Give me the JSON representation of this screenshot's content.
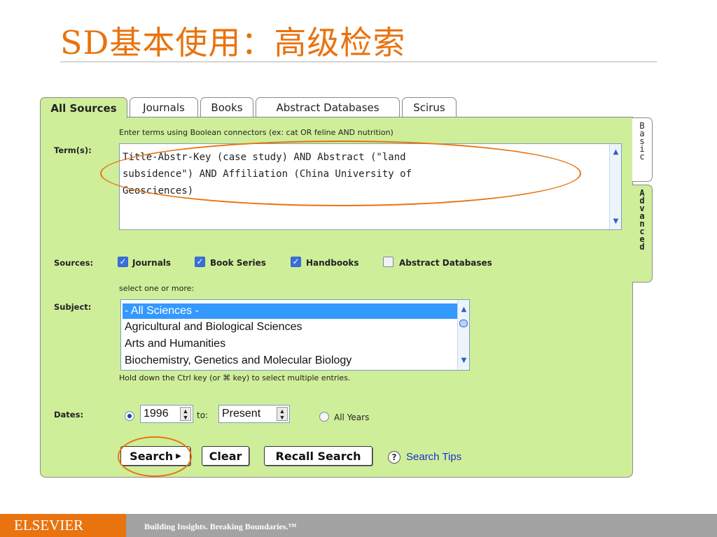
{
  "slide": {
    "title": "SD基本使用：高级检索"
  },
  "tabs": [
    {
      "label": "All Sources",
      "active": true
    },
    {
      "label": "Journals"
    },
    {
      "label": "Books"
    },
    {
      "label": "Abstract Databases"
    },
    {
      "label": "Scirus"
    }
  ],
  "side_tabs": {
    "basic": [
      "B",
      "a",
      "s",
      "i",
      "c"
    ],
    "advanced": [
      "A",
      "d",
      "v",
      "a",
      "n",
      "c",
      "e",
      "d"
    ]
  },
  "terms": {
    "label": "Term(s):",
    "hint": "Enter terms using Boolean connectors (ex: cat OR feline AND nutrition)",
    "lines": [
      "Title-Abstr-Key (case study) AND Abstract (\"land",
      "subsidence\") AND Affiliation (China University of",
      "Geosciences)"
    ]
  },
  "sources": {
    "label": "Sources:",
    "options": [
      {
        "label": "Journals",
        "checked": true
      },
      {
        "label": "Book Series",
        "checked": true
      },
      {
        "label": "Handbooks",
        "checked": true
      },
      {
        "label": "Abstract Databases",
        "checked": false
      }
    ]
  },
  "subject": {
    "label": "Subject:",
    "hint_top": "select one or more:",
    "hint_bottom": "Hold down the Ctrl key (or ⌘ key) to select multiple entries.",
    "items": [
      {
        "label": "- All Sciences -",
        "selected": true
      },
      {
        "label": "Agricultural and Biological Sciences"
      },
      {
        "label": "Arts and Humanities"
      },
      {
        "label": "Biochemistry, Genetics and Molecular Biology"
      }
    ]
  },
  "dates": {
    "label": "Dates:",
    "from_value": "1996",
    "to_label": "to:",
    "to_value": "Present",
    "all_years_label": "All Years",
    "range_selected": true
  },
  "actions": {
    "search": "Search",
    "clear": "Clear",
    "recall": "Recall Search",
    "tips": "Search Tips"
  },
  "footer": {
    "brand": "ELSEVIER",
    "tagline": "Building Insights. Breaking Boundaries.™"
  },
  "colors": {
    "accent_orange": "#e8730f",
    "panel_green": "#cfee9a",
    "selection_blue": "#3399ff",
    "link_blue": "#1a33cc"
  }
}
